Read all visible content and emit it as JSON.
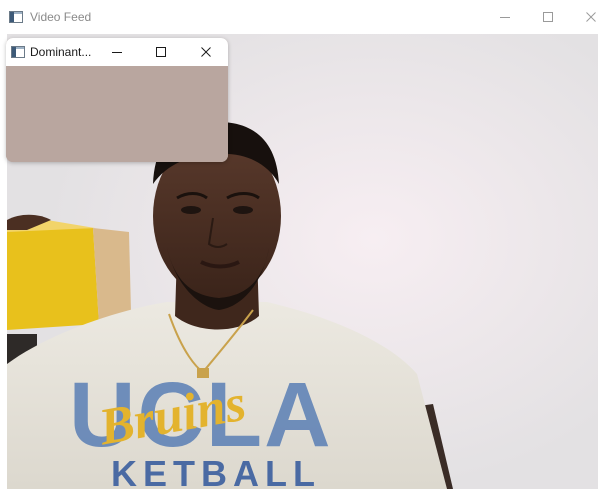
{
  "main_window": {
    "title": "Video Feed",
    "icon": "app-window-icon",
    "buttons": [
      "minimize-icon",
      "maximize-icon",
      "close-icon"
    ]
  },
  "dominant_window": {
    "title": "Dominant...",
    "icon": "app-window-icon",
    "buttons": [
      "minimize-icon",
      "maximize-icon",
      "close-icon"
    ],
    "dominant_color": "#b9a69f"
  },
  "video": {
    "shirt_text": "UCLA",
    "script_text": "Bruins",
    "bottom_text": "KETBALL"
  },
  "colors": {
    "titlebar": "#ffffff",
    "wall": "#ece9eb",
    "shirt": "#e9e6dd",
    "shirt_print_blue": "#5a7fb5",
    "shirt_print_gold": "#e3b32e",
    "box_yellow": "#e8c11c"
  }
}
